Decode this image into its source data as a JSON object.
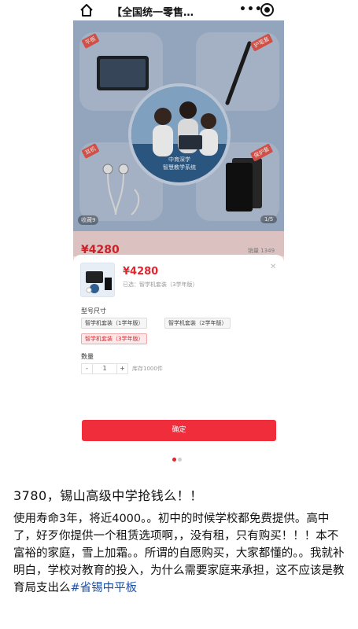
{
  "topbar": {
    "title": "【全国统一零售…",
    "more": "•••"
  },
  "poster": {
    "tiles": [
      {
        "tag": "平板"
      },
      {
        "tag": "护笔套"
      },
      {
        "tag": "耳机"
      },
      {
        "tag": "保护套"
      }
    ],
    "caption_line1": "中育深学",
    "caption_line2": "智慧教学系统",
    "favorite_badge": "收藏9",
    "page_badge": "1/5",
    "price": "¥4280",
    "sales": "销量 1349"
  },
  "sheet": {
    "price": "¥4280",
    "selected": "已选：智学机套装（3学年版）",
    "close": "✕",
    "spec_label": "型号尺寸",
    "options": [
      {
        "label": "智学机套装（1学年版）",
        "selected": false
      },
      {
        "label": "智学机套装（2学年版）",
        "selected": false
      },
      {
        "label": "智学机套装（3学年版）",
        "selected": true
      }
    ],
    "qty_label": "数量",
    "qty_minus": "-",
    "qty_value": "1",
    "qty_plus": "+",
    "stock": "库存1000件",
    "confirm_label": "确定"
  },
  "carousel": {
    "count": 2,
    "active": 0
  },
  "post": {
    "title": "3780，锡山高级中学抢钱么！！",
    "body": "使用寿命3年，将近4000。。初中的时候学校都免费提供。高中了，好歹你提供一个租赁选项啊，，没有租，只有购买！！！本不富裕的家庭，雪上加霜。。所谓的自愿购买，大家都懂的。。我就补明白，学校对教育的投入，为什么需要家庭来承担，这不应该是教育局支出么",
    "hashtag": "#省锡中平板"
  },
  "colors": {
    "accent": "#e0262f",
    "button": "#ef2d3b",
    "hashtag": "#1b4fa3",
    "poster_bg": "#a4b8d2"
  }
}
